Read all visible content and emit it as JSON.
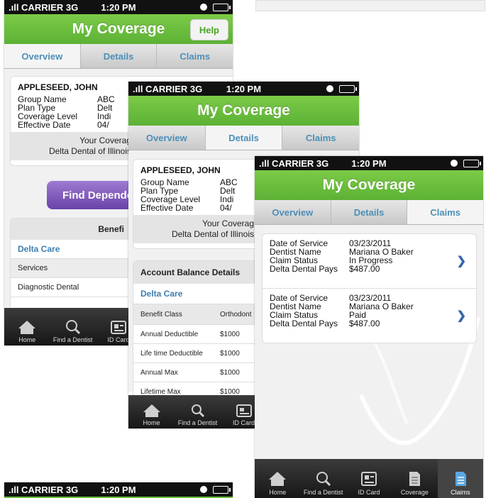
{
  "status": {
    "carrier": ".ıll CARRIER 3G",
    "time": "1:20 PM"
  },
  "app": {
    "title": "My Coverage",
    "help": "Help"
  },
  "tabs": [
    "Overview",
    "Details",
    "Claims"
  ],
  "member": {
    "name": "APPLESEED, JOHN",
    "fields": [
      {
        "label": "Group Name",
        "value": "ABC"
      },
      {
        "label": "Plan Type",
        "value": "Delt"
      },
      {
        "label": "Coverage Level",
        "value": "Indi"
      },
      {
        "label": "Effective Date",
        "value": "04/"
      }
    ],
    "plan_line1": "Your Coverag",
    "plan_line2": "Delta Dental of Illinois"
  },
  "overview": {
    "find_dependents": "Find Dependent",
    "benefits_heading": "Benefi",
    "plan_name": "Delta Care",
    "services_label": "Services",
    "diagnostic": "Diagnostic Dental"
  },
  "details": {
    "account_heading": "Account Balance Details",
    "plan_name": "Delta Care",
    "col_benefit": "Benefit Class",
    "col_ortho": "Orthodont",
    "rows": [
      {
        "label": "Annual Deductible",
        "value": "$1000"
      },
      {
        "label": "Life time Deductible",
        "value": "$1000"
      },
      {
        "label": "Annual Max",
        "value": "$1000"
      },
      {
        "label": "Lifetime Max",
        "value": "$1000"
      }
    ]
  },
  "claims": {
    "labels": [
      "Date of Service",
      "Dentist Name",
      "Claim Status",
      "Delta Dental Pays"
    ],
    "items": [
      {
        "date": "03/23/2011",
        "dentist": "Mariana O Baker",
        "status": "In Progress",
        "pays": "$487.00"
      },
      {
        "date": "03/23/2011",
        "dentist": "Mariana O Baker",
        "status": "Paid",
        "pays": "$487.00"
      }
    ]
  },
  "tabbar": [
    "Home",
    "Find a Dentist",
    "ID Card",
    "Coverage",
    "Claims"
  ],
  "colors": {
    "green": "#6bbf3e",
    "link_blue": "#3f7fb0",
    "purple": "#7b55b8"
  }
}
